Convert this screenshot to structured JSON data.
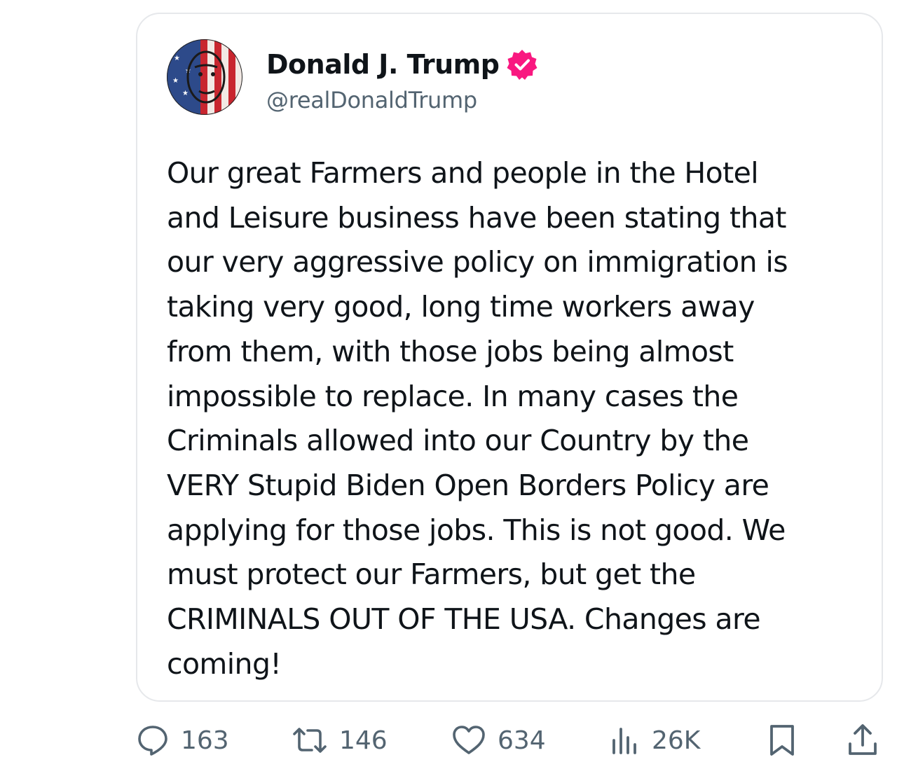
{
  "post": {
    "author": {
      "display_name": "Donald J. Trump",
      "handle": "@realDonaldTrump",
      "verified": true,
      "verified_color": "#f91880"
    },
    "text": "Our great Farmers and people in the Hotel\nand Leisure business have been stating that\nour very aggressive policy on immigration is\ntaking very good, long time workers away\nfrom them, with those jobs being almost\nimpossible to replace. In many cases the\nCriminals allowed into our Country by the\nVERY Stupid Biden Open Borders Policy are\napplying for those jobs. This is not good. We\nmust protect our Farmers, but get the\nCRIMINALS OUT OF THE USA. Changes are\ncoming!"
  },
  "actions": {
    "reply": {
      "icon": "reply-icon",
      "count": "163"
    },
    "repost": {
      "icon": "repost-icon",
      "count": "146"
    },
    "like": {
      "icon": "heart-icon",
      "count": "634"
    },
    "views": {
      "icon": "views-icon",
      "count": "26K"
    },
    "bookmark": {
      "icon": "bookmark-icon"
    },
    "share": {
      "icon": "share-icon"
    }
  },
  "colors": {
    "text_primary": "#0f1419",
    "text_secondary": "#536471",
    "border": "#e6e8eb"
  }
}
